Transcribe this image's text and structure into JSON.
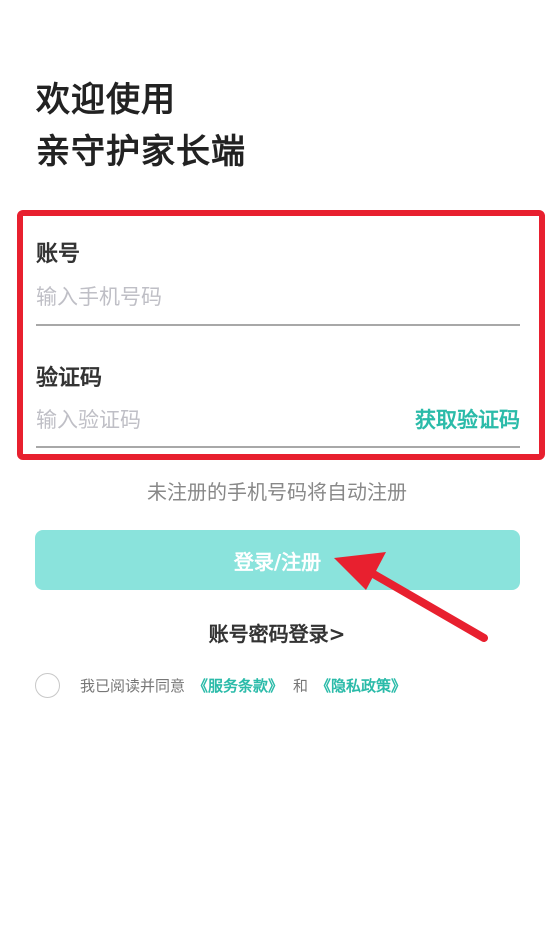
{
  "welcome": {
    "line1": "欢迎使用",
    "line2": "亲守护家长端"
  },
  "account": {
    "label": "账号",
    "placeholder": "输入手机号码",
    "value": ""
  },
  "code": {
    "label": "验证码",
    "placeholder": "输入验证码",
    "value": "",
    "get_code_label": "获取验证码"
  },
  "hint": "未注册的手机号码将自动注册",
  "login_button": "登录/注册",
  "password_login": "账号密码登录>",
  "agreement": {
    "prefix": "我已阅读并同意",
    "terms": "《服务条款》",
    "and": "和",
    "privacy": "《隐私政策》",
    "checked": false
  },
  "colors": {
    "accent": "#2bbba9",
    "button_bg": "#8ae3dc",
    "annotation_red": "#e8202f"
  }
}
